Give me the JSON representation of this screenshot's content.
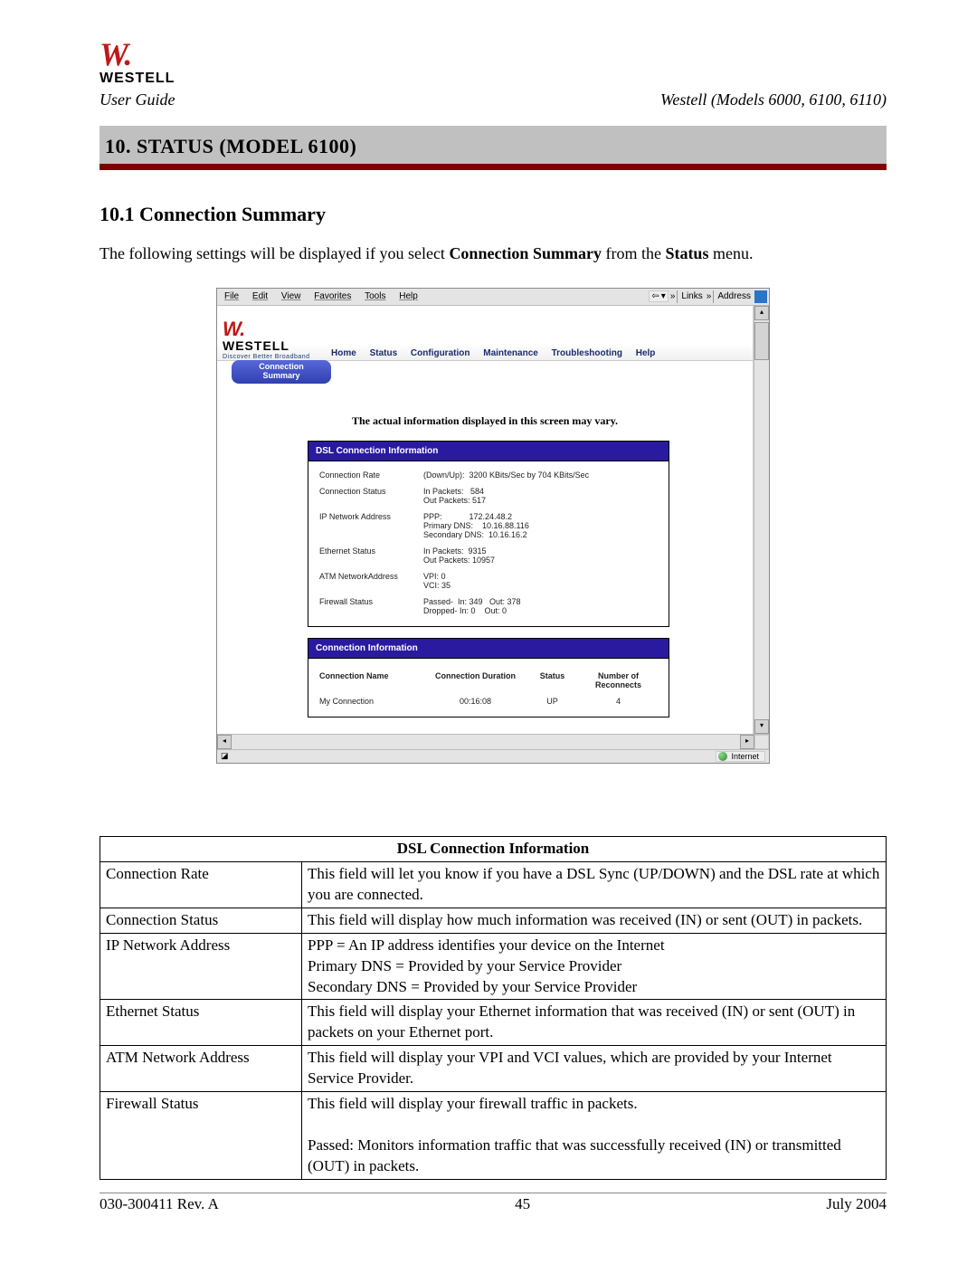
{
  "header": {
    "logo_word": "WESTELL",
    "user_guide": "User Guide",
    "models": "Westell (Models 6000, 6100, 6110)"
  },
  "title": "10.  STATUS (MODEL 6100)",
  "section_heading": "10.1 Connection Summary",
  "intro_prefix": "The following settings will be displayed if you select ",
  "intro_bold1": "Connection Summary",
  "intro_mid": " from the ",
  "intro_bold2": "Status",
  "intro_suffix": " menu.",
  "screenshot": {
    "ie_menu": {
      "file": "File",
      "edit": "Edit",
      "view": "View",
      "favorites": "Favorites",
      "tools": "Tools",
      "help": "Help",
      "back_arrow": "⇦",
      "back_caret": "▾",
      "links": "Links",
      "links_caret": "»",
      "address": "Address"
    },
    "brand": {
      "word": "WESTELL",
      "tagline": "Discover Better Broadband"
    },
    "nav": {
      "home": "Home",
      "status": "Status",
      "configuration": "Configuration",
      "maintenance": "Maintenance",
      "troubleshooting": "Troubleshooting",
      "help": "Help"
    },
    "selected_tab": "Connection\nSummary",
    "note": "The actual information displayed in this screen may vary.",
    "dsl_header": "DSL Connection Information",
    "dsl": {
      "rate_label": "Connection Rate",
      "rate_value": "(Down/Up):  3200 KBits/Sec by 704 KBits/Sec",
      "status_label": "Connection Status",
      "status_value": "In Packets:   584\nOut Packets: 517",
      "ip_label": "IP Network Address",
      "ip_value": "PPP:            172.24.48.2\nPrimary DNS:    10.16.88.116\nSecondary DNS:  10.16.16.2",
      "eth_label": "Ethernet Status",
      "eth_value": "In Packets:  9315\nOut Packets: 10957",
      "atm_label": "ATM NetworkAddress",
      "atm_value": "VPI: 0\nVCI: 35",
      "fw_label": "Firewall Status",
      "fw_value": "Passed-  In: 349   Out: 378\nDropped- In: 0    Out: 0"
    },
    "conn_header": "Connection Information",
    "conn_table": {
      "h1": "Connection Name",
      "h2": "Connection Duration",
      "h3": "Status",
      "h4": "Number of Reconnects",
      "r1": "My Connection",
      "r2": "00:16:08",
      "r3": "UP",
      "r4": "4"
    },
    "scroll": {
      "up": "▴",
      "down": "▾",
      "left": "◂",
      "right": "▸"
    },
    "status_strip": {
      "done_icon": "◪",
      "internet": "Internet"
    }
  },
  "doc_table": {
    "title": "DSL Connection Information",
    "rows": [
      {
        "label": "Connection Rate",
        "desc": "This field will let you know if you have a DSL Sync (UP/DOWN) and the DSL rate at which you are connected."
      },
      {
        "label": "Connection Status",
        "desc": "This field will display how much information was received (IN) or sent (OUT) in packets."
      },
      {
        "label": "IP Network Address",
        "desc": "PPP = An IP address identifies your device on the Internet\nPrimary DNS = Provided by your Service Provider\nSecondary DNS = Provided by your Service Provider"
      },
      {
        "label": "Ethernet Status",
        "desc": "This field will display your Ethernet information that was received (IN) or sent (OUT) in packets on your Ethernet port."
      },
      {
        "label": "ATM Network Address",
        "desc": "This field will display your VPI and VCI values, which are provided by your Internet Service Provider."
      },
      {
        "label": "Firewall Status",
        "desc": "This field will display your firewall traffic in packets.\n\nPassed: Monitors information traffic that was successfully received (IN) or transmitted (OUT) in packets."
      }
    ]
  },
  "footer": {
    "left": "030-300411 Rev. A",
    "center": "45",
    "right": "July 2004"
  }
}
